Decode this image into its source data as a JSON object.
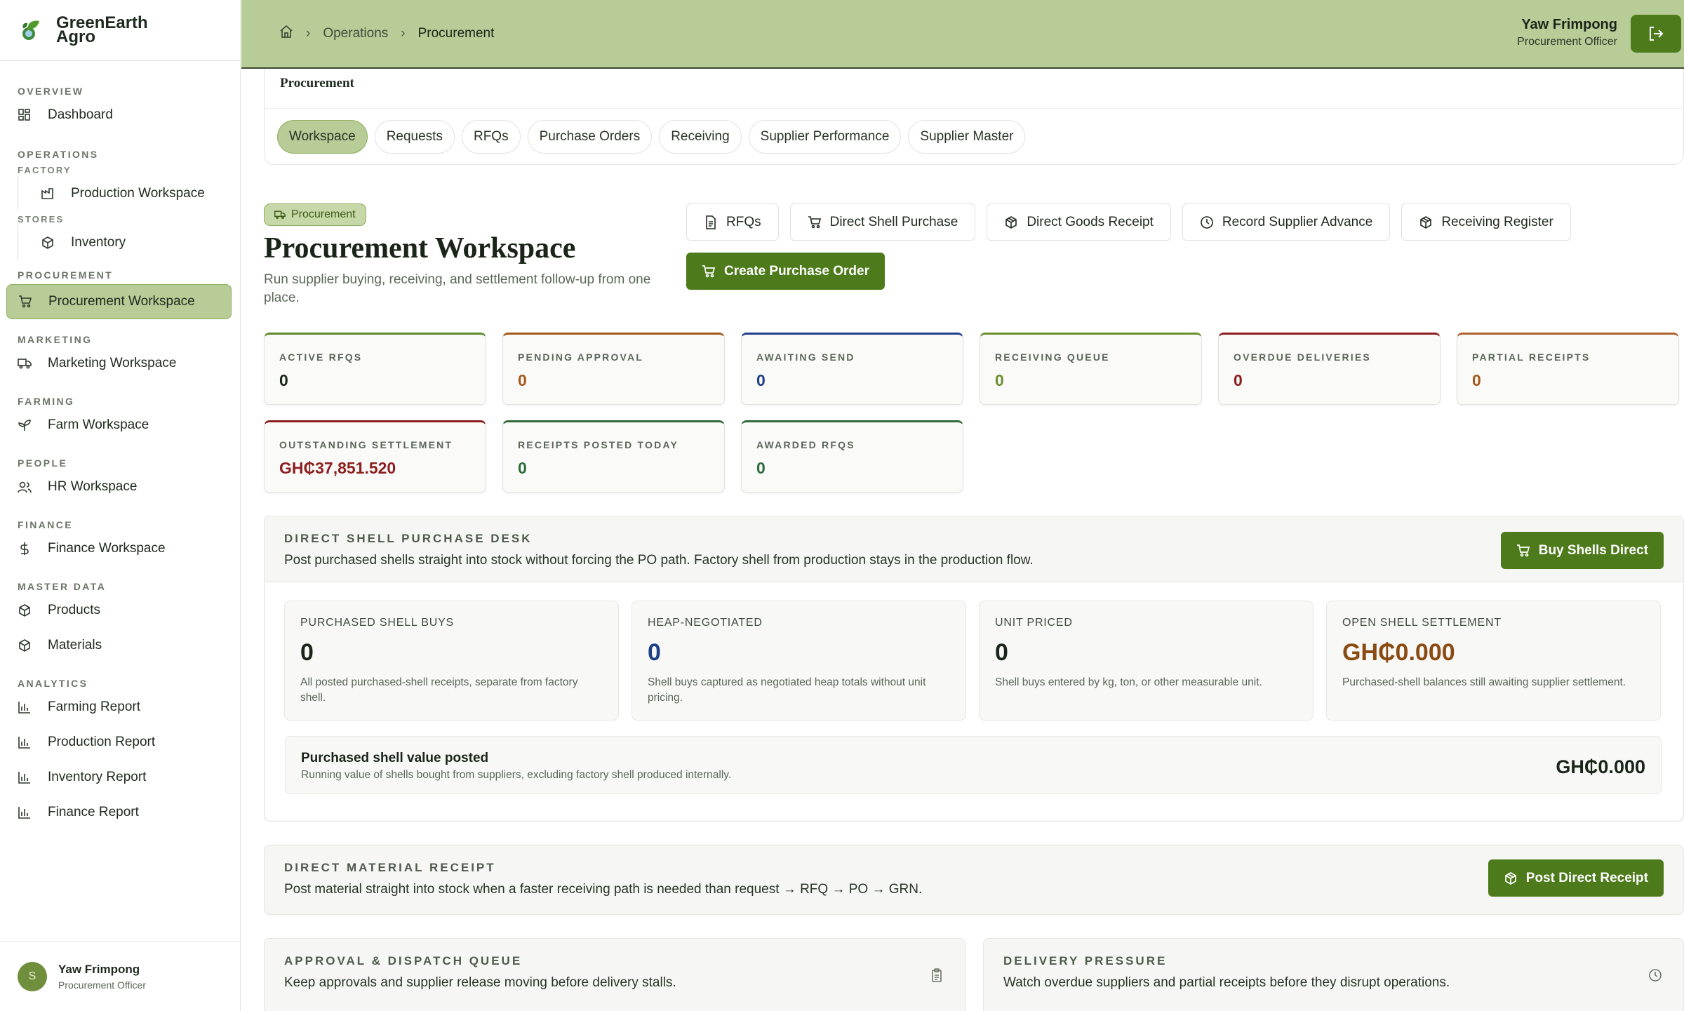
{
  "brand": {
    "name": "GreenEarth Agro"
  },
  "sidebar": {
    "sections": {
      "overview": "OVERVIEW",
      "operations": "OPERATIONS",
      "factory": "FACTORY",
      "stores": "STORES",
      "procurement": "PROCUREMENT",
      "marketing": "MARKETING",
      "farming": "FARMING",
      "people": "PEOPLE",
      "finance": "FINANCE",
      "master_data": "MASTER DATA",
      "analytics": "ANALYTICS"
    },
    "items": {
      "dashboard": "Dashboard",
      "production_workspace": "Production Workspace",
      "inventory": "Inventory",
      "procurement_workspace": "Procurement Workspace",
      "marketing_workspace": "Marketing Workspace",
      "farm_workspace": "Farm Workspace",
      "hr_workspace": "HR Workspace",
      "finance_workspace": "Finance Workspace",
      "products": "Products",
      "materials": "Materials",
      "farming_report": "Farming Report",
      "production_report": "Production Report",
      "inventory_report": "Inventory Report",
      "finance_report": "Finance Report"
    },
    "user": {
      "initial": "S",
      "name": "Yaw Frimpong",
      "role": "Procurement Officer"
    }
  },
  "header": {
    "breadcrumb": [
      "Operations",
      "Procurement"
    ],
    "user_name": "Yaw Frimpong",
    "user_role": "Procurement Officer"
  },
  "tabs": {
    "title": "Procurement",
    "items": [
      "Workspace",
      "Requests",
      "RFQs",
      "Purchase Orders",
      "Receiving",
      "Supplier Performance",
      "Supplier Master"
    ],
    "active": "Workspace"
  },
  "workspace": {
    "badge": "Procurement",
    "title": "Procurement Workspace",
    "subtitle": "Run supplier buying, receiving, and settlement follow-up from one place."
  },
  "actions": {
    "rfqs": "RFQs",
    "direct_shell_purchase": "Direct Shell Purchase",
    "direct_goods_receipt": "Direct Goods Receipt",
    "record_supplier_advance": "Record Supplier Advance",
    "receiving_register": "Receiving Register",
    "create_po": "Create Purchase Order"
  },
  "stats": [
    {
      "label": "ACTIVE RFQS",
      "value": "0",
      "accent": "#5e8a2a",
      "color": "#1a2418"
    },
    {
      "label": "PENDING APPROVAL",
      "value": "0",
      "accent": "#a5581b",
      "color": "#a5581b"
    },
    {
      "label": "AWAITING SEND",
      "value": "0",
      "accent": "#1f3f86",
      "color": "#1f3f86"
    },
    {
      "label": "RECEIVING QUEUE",
      "value": "0",
      "accent": "#6b8e2e",
      "color": "#6b8e2e"
    },
    {
      "label": "OVERDUE DELIVERIES",
      "value": "0",
      "accent": "#8c1e1e",
      "color": "#8c1e1e"
    },
    {
      "label": "PARTIAL RECEIPTS",
      "value": "0",
      "accent": "#b0602a",
      "color": "#a5581b"
    },
    {
      "label": "OUTSTANDING SETTLEMENT",
      "value": "GH₵37,851.520",
      "accent": "#8c1e1e",
      "color": "#8c1e1e"
    },
    {
      "label": "RECEIPTS POSTED TODAY",
      "value": "0",
      "accent": "#2e6a3a",
      "color": "#2e6a3a"
    },
    {
      "label": "AWARDED RFQS",
      "value": "0",
      "accent": "#2e6a3a",
      "color": "#2e6a3a"
    }
  ],
  "shell_desk": {
    "kicker": "DIRECT SHELL PURCHASE DESK",
    "desc": "Post purchased shells straight into stock without forcing the PO path. Factory shell from production stays in the production flow.",
    "button": "Buy Shells Direct",
    "metrics": [
      {
        "label": "PURCHASED SHELL BUYS",
        "value": "0",
        "hint": "All posted purchased-shell receipts, separate from factory shell.",
        "color": "#1a2418"
      },
      {
        "label": "HEAP-NEGOTIATED",
        "value": "0",
        "hint": "Shell buys captured as negotiated heap totals without unit pricing.",
        "color": "#1f3f86"
      },
      {
        "label": "UNIT PRICED",
        "value": "0",
        "hint": "Shell buys entered by kg, ton, or other measurable unit.",
        "color": "#1a2418"
      },
      {
        "label": "OPEN SHELL SETTLEMENT",
        "value": "GH₵0.000",
        "hint": "Purchased-shell balances still awaiting supplier settlement.",
        "color": "#8a4b12"
      }
    ],
    "value_title": "Purchased shell value posted",
    "value_sub": "Running value of shells bought from suppliers, excluding factory shell produced internally.",
    "value_amount": "GH₵0.000"
  },
  "material_receipt": {
    "kicker": "DIRECT MATERIAL RECEIPT",
    "desc": "Post material straight into stock when a faster receiving path is needed than request → RFQ → PO → GRN.",
    "button": "Post Direct Receipt"
  },
  "approval_queue": {
    "kicker": "APPROVAL & DISPATCH QUEUE",
    "desc": "Keep approvals and supplier release moving before delivery stalls."
  },
  "delivery_pressure": {
    "kicker": "DELIVERY PRESSURE",
    "desc": "Watch overdue suppliers and partial receipts before they disrupt operations."
  }
}
